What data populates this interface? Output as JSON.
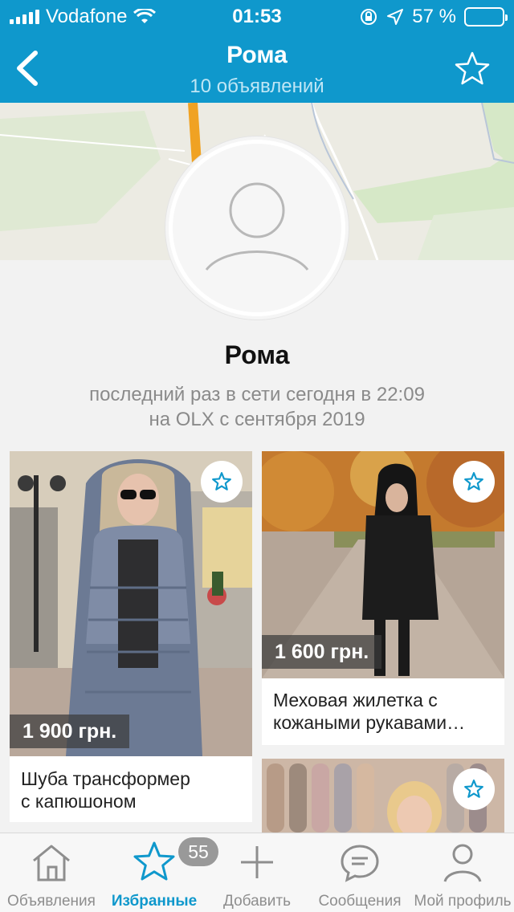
{
  "status_bar": {
    "carrier": "Vodafone",
    "time": "01:53",
    "battery": "57 %",
    "battery_level": 0.57
  },
  "header": {
    "title": "Рома",
    "subtitle": "10 объявлений"
  },
  "profile": {
    "name": "Рома",
    "last_seen": "последний раз в сети сегодня в 22:09",
    "member_since": "на OLX с сентября 2019"
  },
  "listings": [
    {
      "price": "1 900 грн.",
      "title_line1": "Шуба трансформер",
      "title_line2": "с капюшоном"
    },
    {
      "price": "1 600 грн.",
      "title_line1": "Меховая жилетка с",
      "title_line2": "кожаными рукавами…"
    },
    {
      "price": "",
      "title_line1": "",
      "title_line2": ""
    }
  ],
  "tabbar": {
    "items": [
      {
        "label": "Объявления",
        "icon": "home-icon"
      },
      {
        "label": "Избранные",
        "icon": "star-icon",
        "active": true
      },
      {
        "label": "Добавить",
        "icon": "plus-icon"
      },
      {
        "label": "Сообщения",
        "icon": "chat-icon"
      },
      {
        "label": "Мой профиль",
        "icon": "person-icon"
      }
    ],
    "favorites_badge": "55"
  },
  "colors": {
    "brand": "#0f98cc",
    "active_tab": "#0f98cc",
    "inactive_tab": "#8e8e8e"
  }
}
